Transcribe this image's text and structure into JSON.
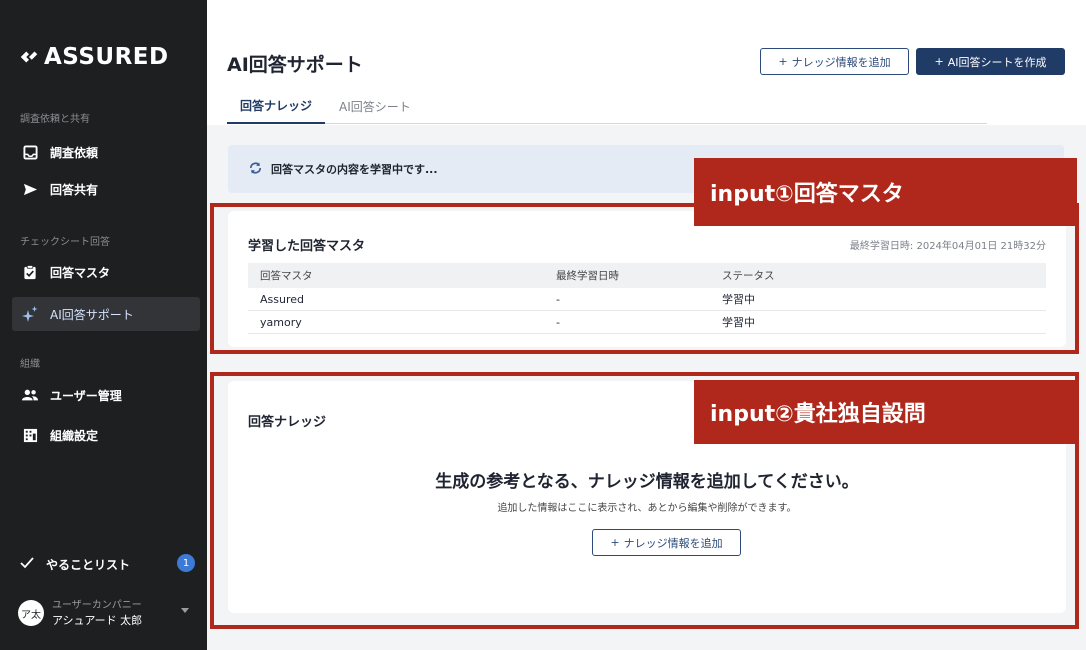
{
  "sidebar": {
    "logo": "ASSURED",
    "sections": [
      {
        "label": "調査依頼と共有",
        "items": [
          {
            "label": "調査依頼"
          },
          {
            "label": "回答共有"
          }
        ]
      },
      {
        "label": "チェックシート回答",
        "items": [
          {
            "label": "回答マスタ"
          },
          {
            "label": "AI回答サポート"
          }
        ]
      },
      {
        "label": "組織",
        "items": [
          {
            "label": "ユーザー管理"
          },
          {
            "label": "組織設定"
          }
        ]
      }
    ],
    "todo": {
      "label": "やることリスト",
      "count": "1"
    },
    "user": {
      "avatar": "ア太",
      "company": "ユーザーカンパニー",
      "name": "アシュアード 太郎"
    }
  },
  "header": {
    "title": "AI回答サポート",
    "add_knowledge_button": "ナレッジ情報を追加",
    "create_sheet_button": "AI回答シートを作成"
  },
  "tabs": [
    {
      "label": "回答ナレッジ",
      "active": true
    },
    {
      "label": "AI回答シート",
      "active": false
    }
  ],
  "banner": {
    "text": "回答マスタの内容を学習中です..."
  },
  "learned_master": {
    "title": "学習した回答マスタ",
    "last_learned": "最終学習日時: 2024年04月01日 21時32分",
    "columns": [
      "回答マスタ",
      "最終学習日時",
      "ステータス"
    ],
    "rows": [
      {
        "name": "Assured",
        "date": "-",
        "status": "学習中"
      },
      {
        "name": "yamory",
        "date": "-",
        "status": "学習中"
      }
    ]
  },
  "knowledge": {
    "title": "回答ナレッジ",
    "empty_title": "生成の参考となる、ナレッジ情報を追加してください。",
    "empty_sub": "追加した情報はここに表示され、あとから編集や削除ができます。",
    "add_button": "ナレッジ情報を追加"
  },
  "annotations": {
    "input1": "input①回答マスタ",
    "input2": "input②貴社独自設問"
  },
  "colors": {
    "accent": "#203b66",
    "annotation": "#b0271b",
    "sidebar": "#1e1f21"
  }
}
